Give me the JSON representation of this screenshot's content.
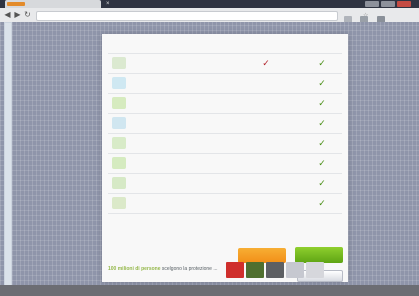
{
  "browser": {
    "tab_title": "",
    "address_text": "",
    "window_controls": [
      "minimize-icon",
      "maximize-icon",
      "close-icon"
    ]
  },
  "table": {
    "feature_header": "",
    "product_1": "",
    "product_2": "",
    "rows": [
      {
        "icon": "shield-icon",
        "text": "",
        "col1": "✓",
        "col2": "✓"
      },
      {
        "icon": "network-icon",
        "text": "",
        "col1": "",
        "col2": "✓"
      },
      {
        "icon": "lock-icon",
        "text": "",
        "col1": "",
        "col2": "✓"
      },
      {
        "icon": "globe-icon",
        "text": "",
        "col1": "",
        "col2": "✓"
      },
      {
        "icon": "family-icon",
        "text": "",
        "col1": "",
        "col2": "✓"
      },
      {
        "icon": "monitor-icon",
        "text": "",
        "col1": "",
        "col2": "✓"
      },
      {
        "icon": "mail-icon",
        "text": "",
        "col1": "",
        "col2": "✓"
      },
      {
        "icon": "settings-icon",
        "text": "",
        "col1": "",
        "col2": "✓"
      }
    ]
  },
  "buttons": {
    "orange_label": "",
    "green_promo": "",
    "green_label": "",
    "light_label": "",
    "note": ""
  },
  "footer": {
    "headline_strong": "100 milioni di persone",
    "headline_rest": "scelgono la protezione ..."
  },
  "colors": {
    "orange": "#f28f17",
    "green": "#5ea414",
    "check_red": "#b2232b",
    "check_green": "#4a8f16"
  }
}
